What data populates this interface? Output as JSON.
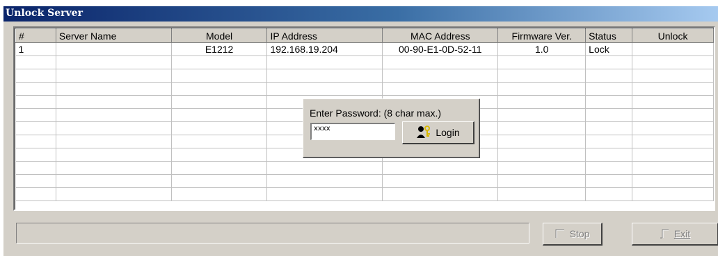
{
  "window": {
    "title": "Unlock Server"
  },
  "table": {
    "columns": [
      "#",
      "Server Name",
      "Model",
      "IP Address",
      "MAC Address",
      "Firmware Ver.",
      "Status",
      "Unlock"
    ],
    "rows": [
      [
        "1",
        "",
        "E1212",
        "192.168.19.204",
        "00-90-E1-0D-52-11",
        "1.0",
        "Lock",
        ""
      ],
      [
        "",
        "",
        "",
        "",
        "",
        "",
        "",
        ""
      ],
      [
        "",
        "",
        "",
        "",
        "",
        "",
        "",
        ""
      ],
      [
        "",
        "",
        "",
        "",
        "",
        "",
        "",
        ""
      ],
      [
        "",
        "",
        "",
        "",
        "",
        "",
        "",
        ""
      ],
      [
        "",
        "",
        "",
        "",
        "",
        "",
        "",
        ""
      ],
      [
        "",
        "",
        "",
        "",
        "",
        "",
        "",
        ""
      ],
      [
        "",
        "",
        "",
        "",
        "",
        "",
        "",
        ""
      ],
      [
        "",
        "",
        "",
        "",
        "",
        "",
        "",
        ""
      ],
      [
        "",
        "",
        "",
        "",
        "",
        "",
        "",
        ""
      ],
      [
        "",
        "",
        "",
        "",
        "",
        "",
        "",
        ""
      ],
      [
        "",
        "",
        "",
        "",
        "",
        "",
        "",
        ""
      ]
    ]
  },
  "password_popup": {
    "label": "Enter Password: (8 char max.)",
    "value": "xxxx",
    "login_label": "Login",
    "login_icon": "key-person-icon"
  },
  "status": {
    "text": ""
  },
  "buttons": {
    "stop_label": "Stop",
    "exit_label": "Exit",
    "stop_icon": "stop-icon",
    "exit_icon": "exit-icon"
  }
}
